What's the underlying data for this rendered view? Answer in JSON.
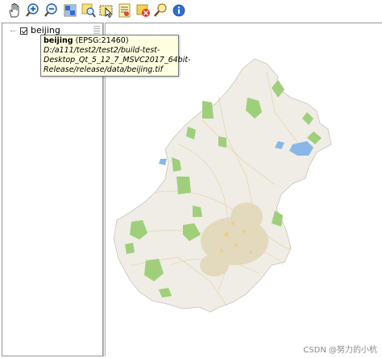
{
  "toolbar": {
    "buttons": [
      {
        "name": "pan-button",
        "icon": "hand-icon"
      },
      {
        "name": "zoom-in-button",
        "icon": "zoom-in-icon"
      },
      {
        "name": "zoom-out-button",
        "icon": "zoom-out-icon"
      },
      {
        "name": "zoom-full-button",
        "icon": "zoom-full-icon"
      },
      {
        "name": "zoom-layer-button",
        "icon": "zoom-layer-icon"
      },
      {
        "name": "select-button",
        "icon": "select-icon"
      },
      {
        "name": "identify-button",
        "icon": "identify-icon"
      },
      {
        "name": "clear-selection-button",
        "icon": "clear-selection-icon"
      },
      {
        "name": "search-button",
        "icon": "search-icon"
      },
      {
        "name": "info-button",
        "icon": "info-icon"
      }
    ]
  },
  "layers": {
    "items": [
      {
        "name": "beijing",
        "checked": true
      }
    ]
  },
  "tooltip": {
    "layer_name": "beijing",
    "crs": " (EPSG:21460)",
    "path": "D:/a111/test2/test2/build-test-Desktop_Qt_5_12_7_MSVC2017_64bit-Release/release/data/beijing.tif"
  },
  "colors": {
    "land": "#efede6",
    "green": "#9fcf7a",
    "water": "#8bb7e6",
    "roads": "#f2c36b"
  },
  "watermark": "CSDN @努力的小杭"
}
